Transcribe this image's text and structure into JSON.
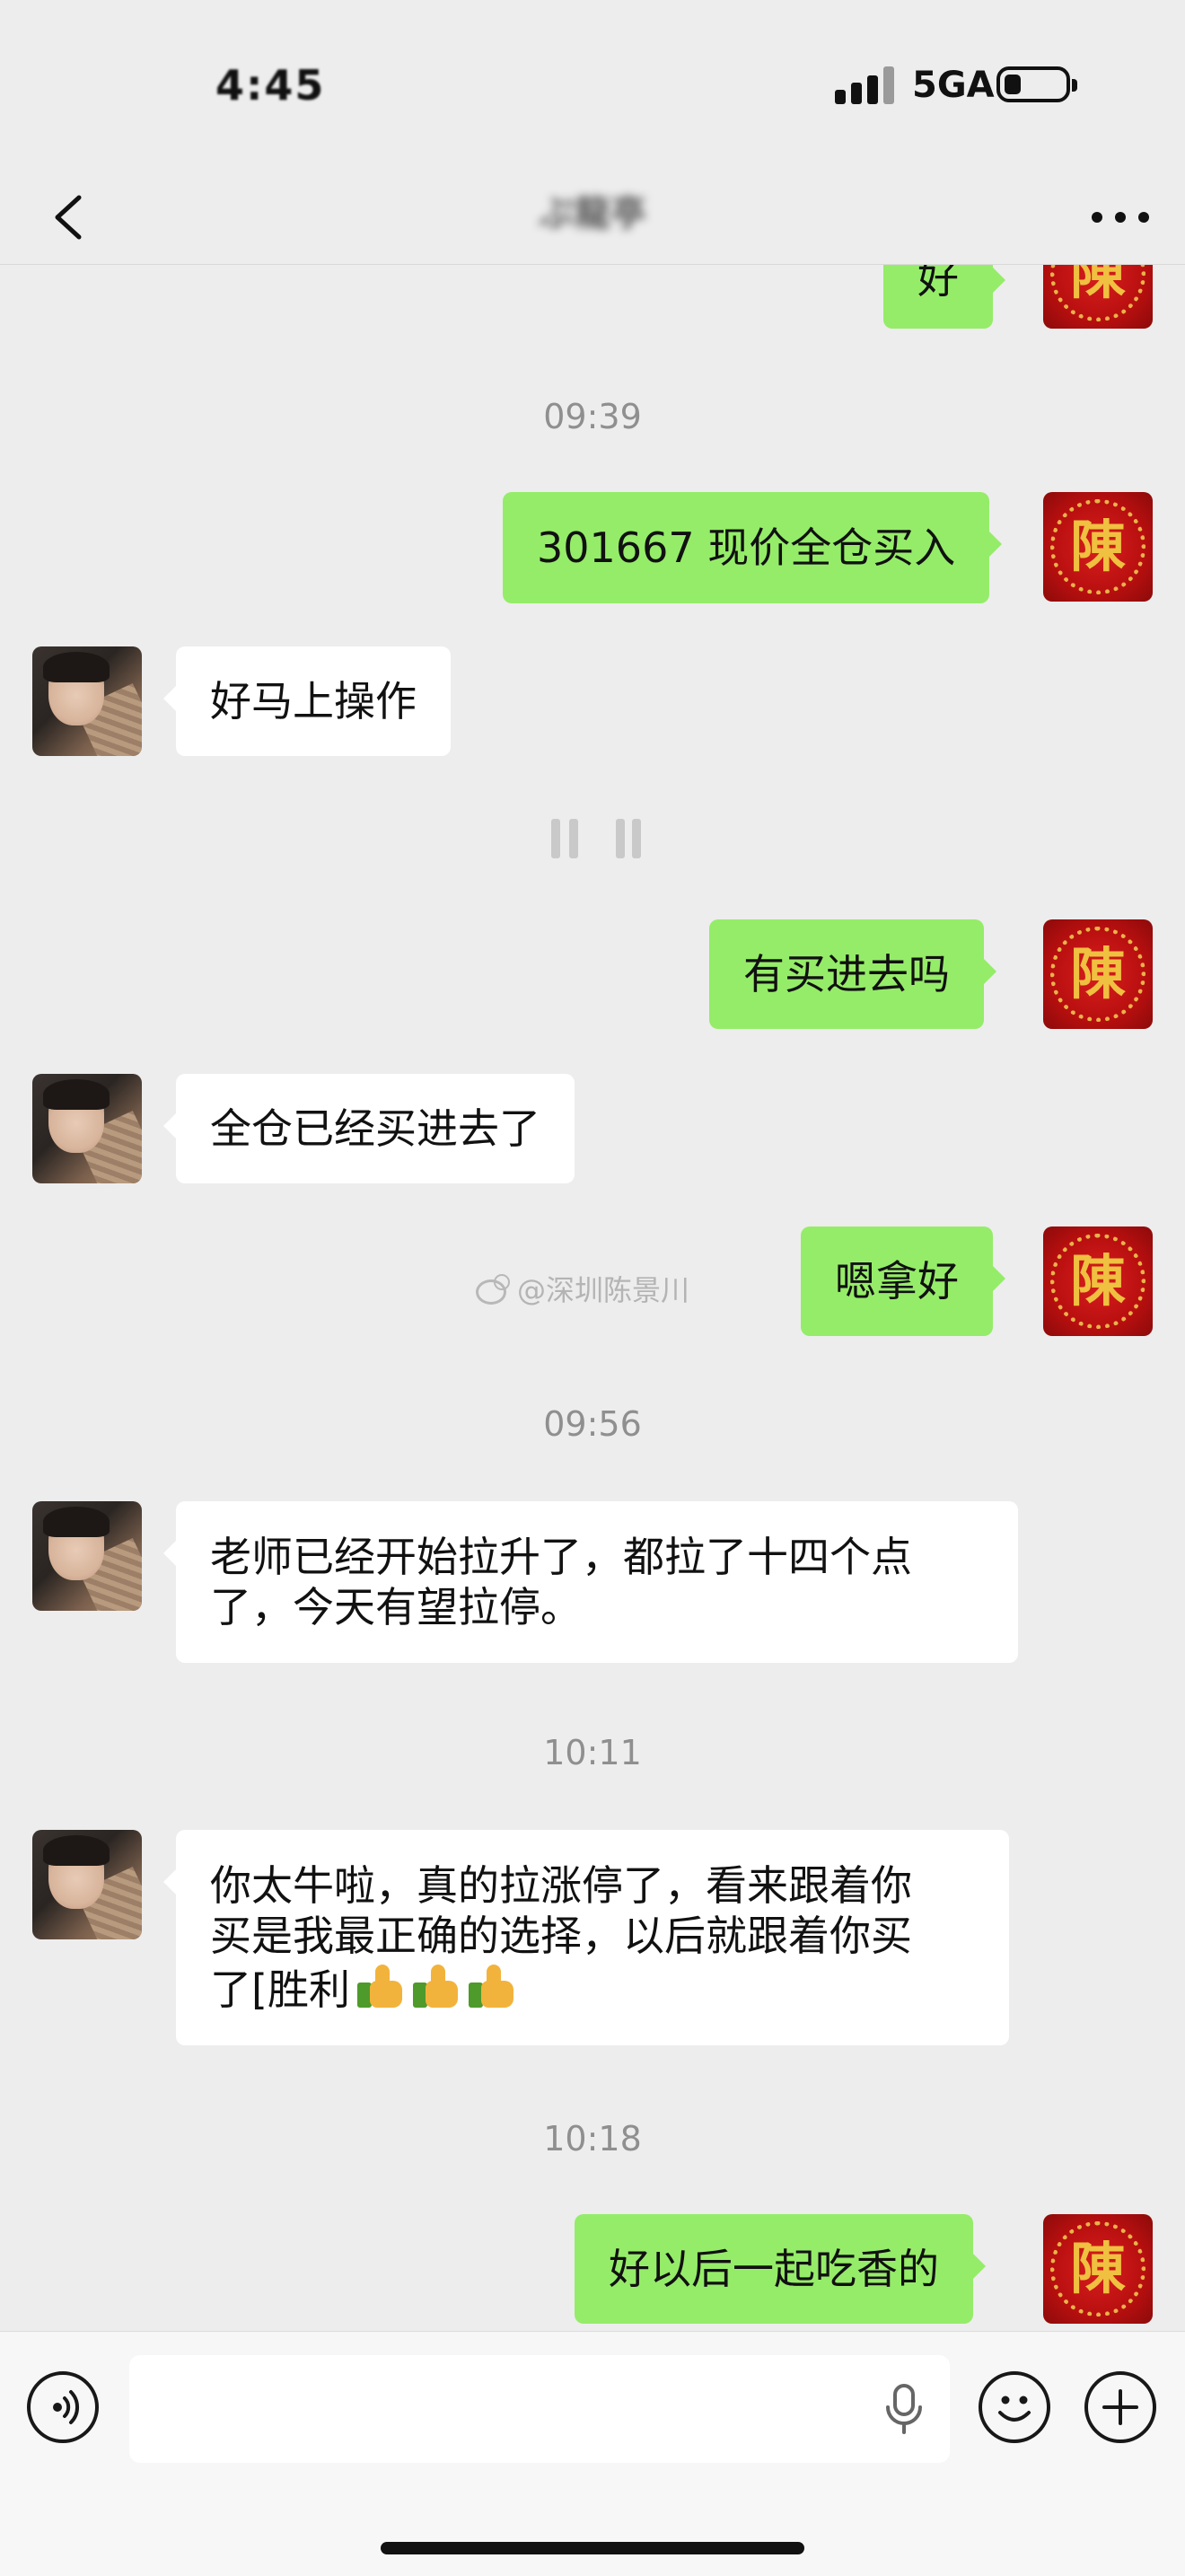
{
  "status_bar": {
    "time": "4:45",
    "network": "5GA",
    "icons": [
      "signal-icon",
      "battery-icon"
    ]
  },
  "nav": {
    "title": "ぷ龍亭",
    "back_icon": "chevron-left-icon",
    "more_icon": "more-dots-icon"
  },
  "colors": {
    "background": "#ededed",
    "bubble_outgoing": "#95ec69",
    "bubble_incoming": "#ffffff",
    "timestamp_text": "#8f8f8f"
  },
  "messages": [
    {
      "from": "me",
      "text": "好"
    },
    {
      "timestamp": "09:39"
    },
    {
      "from": "me",
      "text": "301667 现价全仓买入"
    },
    {
      "from": "other",
      "text": "好马上操作"
    },
    {
      "from": "me",
      "text": "有买进去吗"
    },
    {
      "from": "other",
      "text": "全仓已经买进去了"
    },
    {
      "from": "me",
      "text": "嗯拿好"
    },
    {
      "timestamp": "09:56"
    },
    {
      "from": "other",
      "lines": [
        "老师已经开始拉升了，都拉了十四个点",
        "了，今天有望拉停。"
      ]
    },
    {
      "timestamp": "10:11"
    },
    {
      "from": "other",
      "lines": [
        "你太牛啦，真的拉涨停了，看来跟着你",
        "买是我最正确的选择，以后就跟着你买",
        "了[胜利"
      ],
      "emoji": [
        "thumbs-up-icon",
        "thumbs-up-icon",
        "thumbs-up-icon"
      ]
    },
    {
      "timestamp": "10:18"
    },
    {
      "from": "me",
      "text": "好以后一起吃香的"
    }
  ],
  "avatars": {
    "me_glyph": "陳",
    "me_icon": "red-seal-avatar",
    "other_icon": "photo-avatar"
  },
  "watermark": "@深圳陈景川",
  "input_bar": {
    "voice_icon": "voice-toggle-icon",
    "mic_icon": "microphone-icon",
    "emoji_icon": "emoji-icon",
    "plus_icon": "plus-icon",
    "text_value": ""
  }
}
